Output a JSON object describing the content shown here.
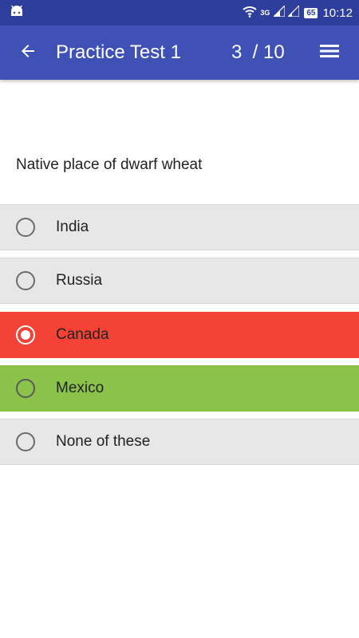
{
  "status_bar": {
    "network_label": "3G",
    "battery_level": "65",
    "time": "10:12",
    "icons": [
      "android-icon",
      "wifi-icon",
      "signal-icon",
      "signal-icon",
      "battery-icon"
    ]
  },
  "app_bar": {
    "title": "Practice Test 1",
    "counter": "3  / 10",
    "back_icon": "arrow-back-icon",
    "menu_icon": "menu-icon",
    "background": "#3f51b5"
  },
  "question": {
    "text": "Native place of dwarf wheat"
  },
  "options": [
    {
      "label": "India",
      "state": "default",
      "selected": false
    },
    {
      "label": "Russia",
      "state": "default",
      "selected": false
    },
    {
      "label": "Canada",
      "state": "wrong",
      "selected": true
    },
    {
      "label": "Mexico",
      "state": "correct",
      "selected": false
    },
    {
      "label": "None of these",
      "state": "default",
      "selected": false
    }
  ],
  "colors": {
    "wrong": "#f44336",
    "correct": "#8bc34a",
    "default": "#e7e7e7"
  }
}
